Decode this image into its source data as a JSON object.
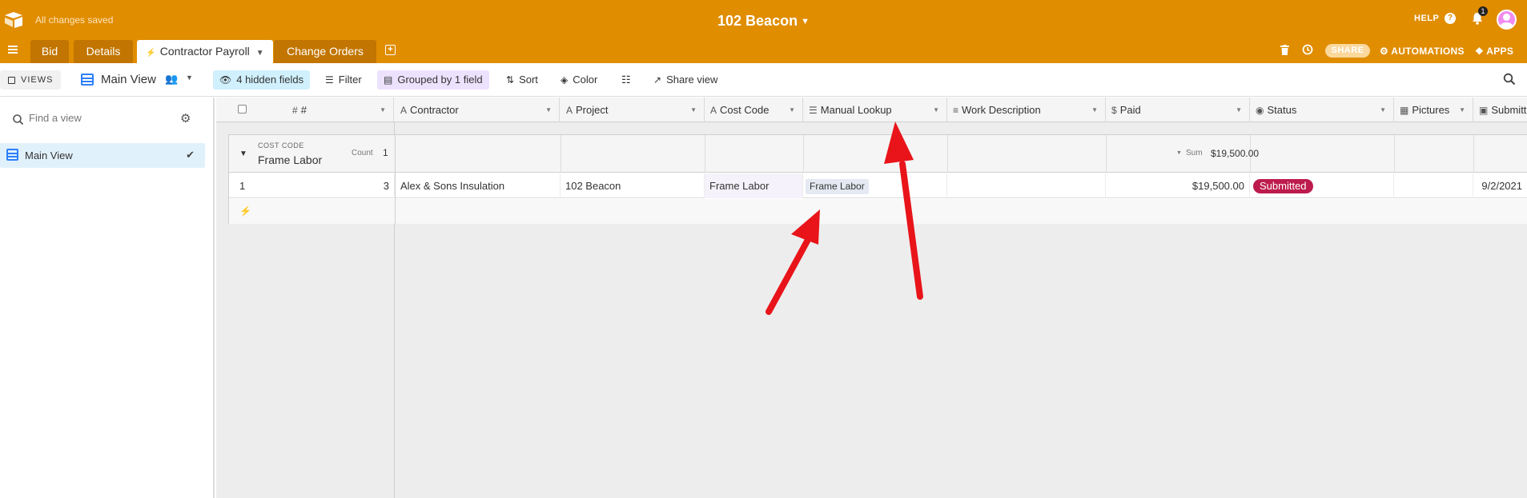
{
  "header": {
    "save_status": "All changes saved",
    "base_name": "102 Beacon",
    "help_label": "HELP",
    "notification_count": "1"
  },
  "tabs": [
    {
      "label": "Bid",
      "active": false
    },
    {
      "label": "Details",
      "active": false
    },
    {
      "label": "Contractor Payroll",
      "active": true
    },
    {
      "label": "Change Orders",
      "active": false
    }
  ],
  "tab_actions": {
    "share_label": "SHARE",
    "automations_label": "AUTOMATIONS",
    "apps_label": "APPS"
  },
  "toolbar": {
    "views_label": "VIEWS",
    "current_view": "Main View",
    "hidden_fields": "4 hidden fields",
    "filter": "Filter",
    "grouped": "Grouped by 1 field",
    "sort": "Sort",
    "color": "Color",
    "share_view": "Share view"
  },
  "sidebar": {
    "find_placeholder": "Find a view",
    "views": [
      {
        "label": "Main View",
        "selected": true
      }
    ]
  },
  "table": {
    "columns": [
      {
        "label": "#",
        "icon": "number-icon"
      },
      {
        "label": "Contractor",
        "icon": "formula-text-icon"
      },
      {
        "label": "Project",
        "icon": "formula-text-icon"
      },
      {
        "label": "Cost Code",
        "icon": "formula-text-icon"
      },
      {
        "label": "Manual Lookup",
        "icon": "lookup-icon"
      },
      {
        "label": "Work Description",
        "icon": "long-text-icon"
      },
      {
        "label": "Paid",
        "icon": "currency-icon"
      },
      {
        "label": "Status",
        "icon": "single-select-icon"
      },
      {
        "label": "Pictures",
        "icon": "attachment-icon"
      },
      {
        "label": "Submitt",
        "icon": "date-icon"
      }
    ],
    "group": {
      "field_label": "COST CODE",
      "value": "Frame Labor",
      "count_label": "Count",
      "count": "1",
      "sum_label": "Sum",
      "sum_value": "$19,500.00"
    },
    "rows": [
      {
        "row_number": "1",
        "number": "3",
        "contractor": "Alex & Sons Insulation",
        "project": "102 Beacon",
        "cost_code": "Frame Labor",
        "manual_lookup": "Frame Labor",
        "work_description": "",
        "paid": "$19,500.00",
        "status": "Submitted",
        "submitted": "9/2/2021"
      }
    ]
  },
  "colors": {
    "header_bg": "#e08d00",
    "status_submitted": "#bd1b4d",
    "annotation_arrow": "#e8141a"
  }
}
